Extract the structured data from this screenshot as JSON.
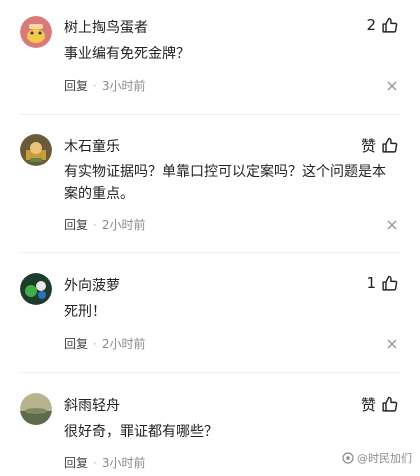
{
  "comments": [
    {
      "username": "树上掏鸟蛋者",
      "like_count": "2",
      "text": "事业编有免死金牌？",
      "reply_label": "回复",
      "time": "3小时前"
    },
    {
      "username": "木石童乐",
      "like_count": "赞",
      "text": "有实物证据吗？单靠口控可以定案吗？这个问题是本案的重点。",
      "reply_label": "回复",
      "time": "2小时前"
    },
    {
      "username": "外向菠萝",
      "like_count": "1",
      "text": "死刑！",
      "reply_label": "回复",
      "time": "2小时前"
    },
    {
      "username": "斜雨轻舟",
      "like_count": "赞",
      "text": "很好奇，罪证都有哪些？",
      "reply_label": "回复",
      "time": "3小时前"
    }
  ],
  "watermark": "@时民加们",
  "separator": "·"
}
